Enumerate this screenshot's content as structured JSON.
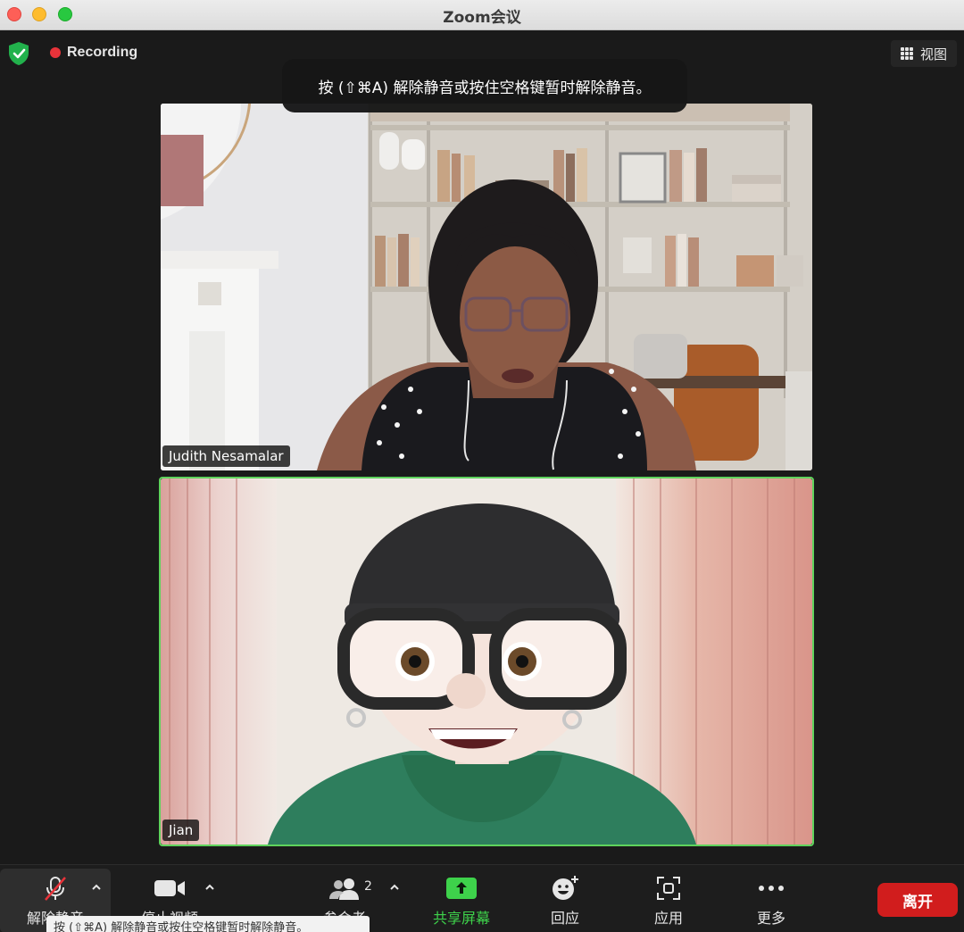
{
  "window": {
    "title": "Zoom会议"
  },
  "topbar": {
    "security_icon": "shield-check-icon",
    "recording_label": "Recording",
    "view_label": "视图",
    "colors": {
      "recording_dot": "#e8333a",
      "security": "#22b14c"
    }
  },
  "banner": {
    "text": "按 (⇧⌘A) 解除静音或按住空格键暂时解除静音。"
  },
  "participants": [
    {
      "name": "Judith Nesamalar"
    },
    {
      "name": "Jian"
    }
  ],
  "toolbar": {
    "unmute": {
      "label": "解除静音",
      "icon": "muted-mic-icon"
    },
    "video": {
      "label": "停止视频",
      "icon": "video-camera-icon"
    },
    "participants": {
      "label": "参会者",
      "count": "2",
      "icon": "participants-icon"
    },
    "share": {
      "label": "共享屏幕",
      "icon": "share-screen-icon",
      "color": "#3ed24b"
    },
    "reactions": {
      "label": "回应",
      "icon": "emoji-add-icon"
    },
    "apps": {
      "label": "应用",
      "icon": "apps-icon"
    },
    "more": {
      "label": "更多",
      "icon": "more-dots-icon"
    },
    "leave": {
      "label": "离开",
      "color": "#d11d1d"
    }
  },
  "tooltip": {
    "text": "按 (⇧⌘A) 解除静音或按住空格键暂时解除静音。"
  }
}
